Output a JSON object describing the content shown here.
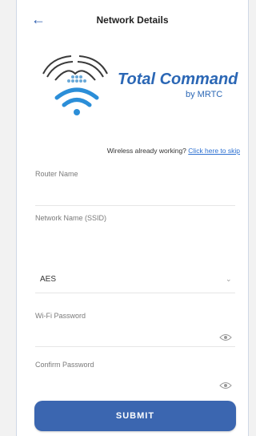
{
  "header": {
    "title": "Network Details"
  },
  "logo": {
    "brand": "Total Command",
    "sub": "by MRTC"
  },
  "skip": {
    "text": "Wireless already working?",
    "link": "Click here to skip"
  },
  "fields": {
    "router_label": "Router Name",
    "ssid_label": "Network Name (SSID)",
    "encryption_value": "AES",
    "password_label": "Wi-Fi Password",
    "confirm_label": "Confirm Password"
  },
  "submit_label": "SUBMIT",
  "colors": {
    "brand": "#2b67b5",
    "button": "#3b66b0",
    "link": "#2b6fd1"
  },
  "icons": [
    "back-arrow-icon",
    "wifi-icon",
    "chevron-down-icon",
    "eye-icon"
  ]
}
